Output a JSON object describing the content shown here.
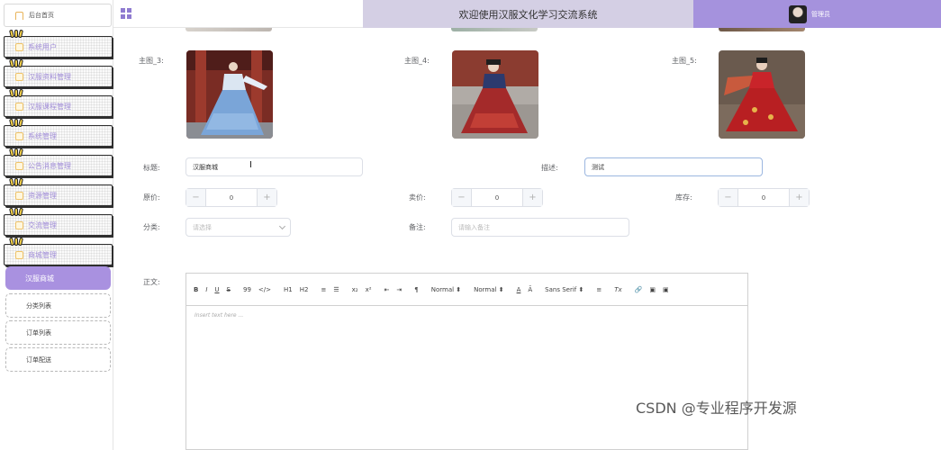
{
  "sidebar": {
    "home": "后台首页",
    "menu": [
      {
        "label": "系统用户"
      },
      {
        "label": "汉服资料管理"
      },
      {
        "label": "汉服课程管理"
      },
      {
        "label": "系统管理"
      },
      {
        "label": "公告消息管理"
      },
      {
        "label": "资源管理"
      },
      {
        "label": "交流管理"
      },
      {
        "label": "商城管理"
      }
    ],
    "active_sub": "汉服商城",
    "sub_items": [
      "分类列表",
      "订单列表",
      "订单配送"
    ]
  },
  "header": {
    "title": "欢迎使用汉服文化学习交流系统",
    "username": "管理员"
  },
  "form": {
    "img3_label": "主图_3:",
    "img4_label": "主图_4:",
    "img5_label": "主图_5:",
    "title_label": "标题:",
    "title_value": "汉服商城",
    "desc_label": "描述:",
    "desc_value": "测试",
    "orig_price_label": "原价:",
    "orig_price_value": "0",
    "sale_price_label": "卖价:",
    "sale_price_value": "0",
    "stock_label": "库存:",
    "stock_value": "0",
    "category_label": "分类:",
    "category_placeholder": "请选择",
    "remark_label": "备注:",
    "remark_placeholder": "请输入备注",
    "body_label": "正文:"
  },
  "editor": {
    "toolbar": [
      "B",
      "I",
      "U",
      "S",
      "99",
      "</>",
      "H1",
      "H2",
      "≡",
      "☰",
      "x₂",
      "x²",
      "⇤",
      "⇥",
      "¶",
      "Normal ⬍",
      "Normal ⬍",
      "A",
      "Ā",
      "Sans Serif ⬍",
      "≡",
      "Tx",
      "🔗",
      "▣",
      "▣"
    ],
    "placeholder": "Insert text here ..."
  },
  "watermark": "CSDN @专业程序开发源",
  "colors": {
    "accent": "#a592dd",
    "header_mid": "#d4cfe4",
    "menu_text": "#a08cd8"
  }
}
